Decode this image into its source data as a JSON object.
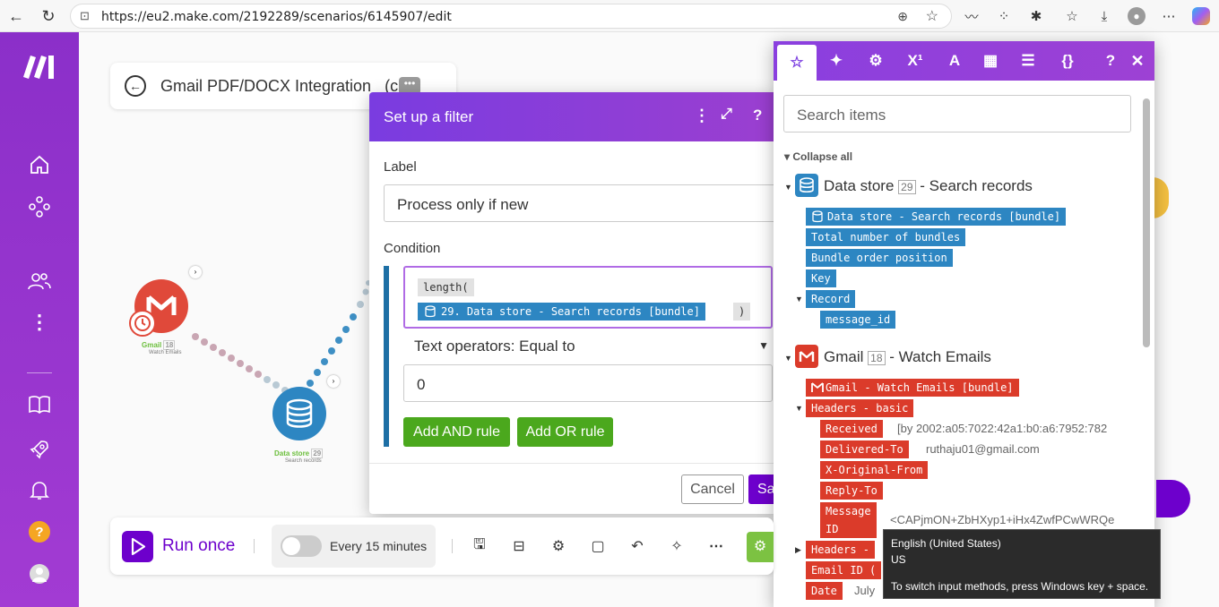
{
  "browser": {
    "url": "https://eu2.make.com/2192289/scenarios/6145907/edit"
  },
  "scenario": {
    "title": "Gmail PDF/DOCX Integration",
    "title_suffix": "(c",
    "nodes": [
      {
        "name": "Gmail",
        "badge": "18",
        "sub": "Watch Emails"
      },
      {
        "name": "Data store",
        "badge": "29",
        "sub": "Search records"
      }
    ]
  },
  "filter": {
    "title": "Set up a filter",
    "label_caption": "Label",
    "label_value": "Process only if new",
    "condition_caption": "Condition",
    "func_chip": "length(",
    "bundle_chip": "29. Data store - Search records [bundle]",
    "close_paren": ")",
    "operator": "Text operators: Equal to",
    "compare_value": "0",
    "add_and": "Add AND rule",
    "add_or": "Add OR rule",
    "cancel": "Cancel",
    "save": "Sa"
  },
  "picker": {
    "search_placeholder": "Search items",
    "collapse_all": "Collapse all",
    "datastore_module": {
      "title": "Data store",
      "num": "29",
      "sub": "- Search records"
    },
    "datastore_items": [
      "Data store - Search records [bundle]",
      "Total number of bundles",
      "Bundle order position",
      "Key",
      "Record",
      "message_id"
    ],
    "gmail_module": {
      "title": "Gmail",
      "num": "18",
      "sub": "- Watch Emails"
    },
    "gmail_items": {
      "bundle": "Gmail - Watch Emails [bundle]",
      "headers_basic": "Headers - basic",
      "received": "Received",
      "received_val": "[by 2002:a05:7022:42a1:b0:a6:7952:782",
      "delivered_to": "Delivered-To",
      "delivered_val": "ruthaju01@gmail.com",
      "x_original_from": "X-Original-From",
      "reply_to": "Reply-To",
      "message_id_1": "Message",
      "message_id_2": "ID",
      "message_val": "<CAPjmON+ZbHXyp1+iHx4ZwfPCwWRQe",
      "headers_other": "Headers -",
      "email_id": "Email ID (",
      "date": "Date",
      "date_val": "July"
    }
  },
  "bottom": {
    "run_once": "Run once",
    "schedule": "Every 15 minutes"
  },
  "tooltip": {
    "line1": "English (United States)",
    "line2": "US",
    "line3": "To switch input methods, press Windows key + space."
  },
  "colors": {
    "brand_purple": "#6d00cc",
    "sidebar": "#9a37d2",
    "datastore_blue": "#2d86c2",
    "gmail_red": "#db3b2a",
    "green_button": "#4ba81d"
  }
}
